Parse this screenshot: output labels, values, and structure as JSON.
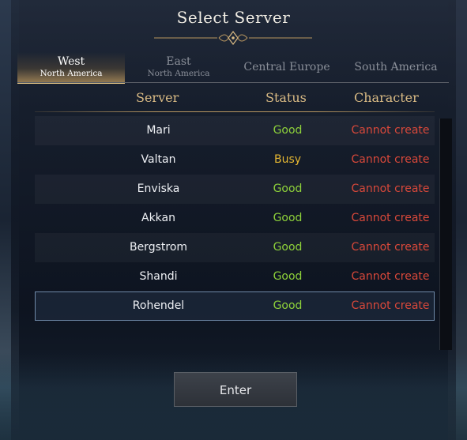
{
  "title": "Select Server",
  "tabs": [
    {
      "label": "West",
      "sublabel": "North America",
      "active": true
    },
    {
      "label": "East",
      "sublabel": "North America",
      "active": false
    },
    {
      "label": "Central Europe",
      "sublabel": "",
      "active": false
    },
    {
      "label": "South America",
      "sublabel": "",
      "active": false
    }
  ],
  "columns": {
    "server": "Server",
    "status": "Status",
    "character": "Character"
  },
  "servers": [
    {
      "name": "Mari",
      "status": "Good",
      "character": "Cannot create"
    },
    {
      "name": "Valtan",
      "status": "Busy",
      "character": "Cannot create"
    },
    {
      "name": "Enviska",
      "status": "Good",
      "character": "Cannot create"
    },
    {
      "name": "Akkan",
      "status": "Good",
      "character": "Cannot create"
    },
    {
      "name": "Bergstrom",
      "status": "Good",
      "character": "Cannot create"
    },
    {
      "name": "Shandi",
      "status": "Good",
      "character": "Cannot create"
    },
    {
      "name": "Rohendel",
      "status": "Good",
      "character": "Cannot create"
    }
  ],
  "selected_server": "Rohendel",
  "enter_label": "Enter",
  "colors": {
    "good": "#8ed23a",
    "busy": "#e4b632",
    "cannot_create": "#d9483a",
    "accent_gold": "#d9ba84"
  }
}
